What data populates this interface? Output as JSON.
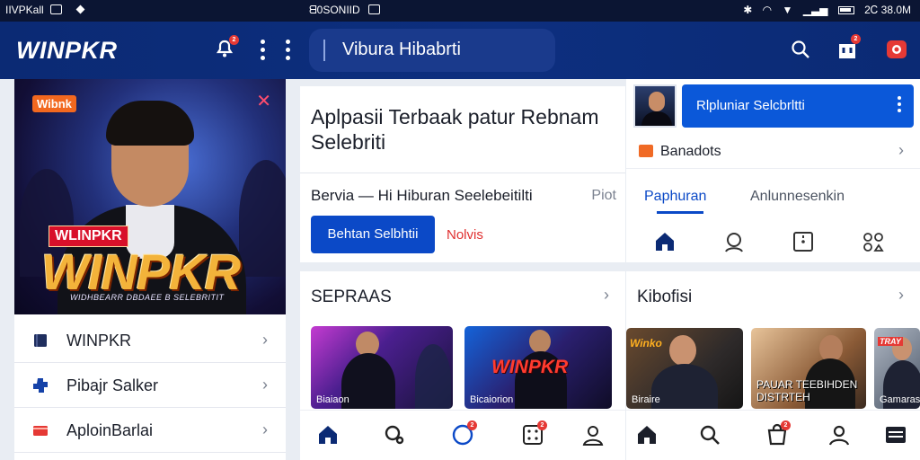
{
  "status_bar": {
    "left_text": "IIVPKall",
    "center_text": "ᗺ0SONIID",
    "time": "2Ꮯ 38.0M"
  },
  "app_bar": {
    "logo": "WINPKR",
    "notification_badge": "2",
    "search_text": "Vibura Hibabrti",
    "cart_badge": "2"
  },
  "hero": {
    "tag": "Wibnk",
    "badge": "WLINPKR",
    "big_logo": "WINPKR",
    "caption": "WIDHBEARR DBDAEE B SELEBRITIT"
  },
  "left_menu": [
    {
      "label": "WINPKR",
      "icon": "book-icon",
      "color": "#1f2e5e"
    },
    {
      "label": "Pibajr Salker",
      "icon": "puzzle-icon",
      "color": "#1542a8"
    },
    {
      "label": "AploinBarlai",
      "icon": "card-icon",
      "color": "#e53935"
    }
  ],
  "intro_card": {
    "title": "Aplpasii Terbaak patur Rebnam Selebriti",
    "subtitle": "Bervia — Hi Hiburan Seelebeitilti",
    "side_text": "Piot",
    "primary_button": "Behtan Selbhtii",
    "secondary_link": "Nolvis"
  },
  "profile_card": {
    "pill_text": "Rlpluniar Selcbrltti",
    "row_label": "Banadots",
    "tab_active": "Paphuran",
    "tab_other": "Anlunnesenkin"
  },
  "selebritas": {
    "title": "SEPRAAS",
    "thumbs": [
      {
        "caption": "Biaiaon"
      },
      {
        "caption": "Bicaiorion",
        "overlay": "WINPKR"
      }
    ],
    "nav_badge_1": "2",
    "nav_badge_2": "2"
  },
  "kibofisi": {
    "title": "Kibofisi",
    "thumbs": [
      {
        "caption": "Biraire",
        "tag": "Winko"
      },
      {
        "caption": "",
        "lines": "PAUAR TEEBIHDEN\nDISTRTEH"
      },
      {
        "caption": "Gamarasi",
        "tag": "TRAY"
      }
    ],
    "nav_badge": "2"
  },
  "colors": {
    "app_bar": "#0b2a74",
    "status_bar": "#0b1533",
    "primary": "#0b49c7",
    "accent_red": "#e53935"
  }
}
